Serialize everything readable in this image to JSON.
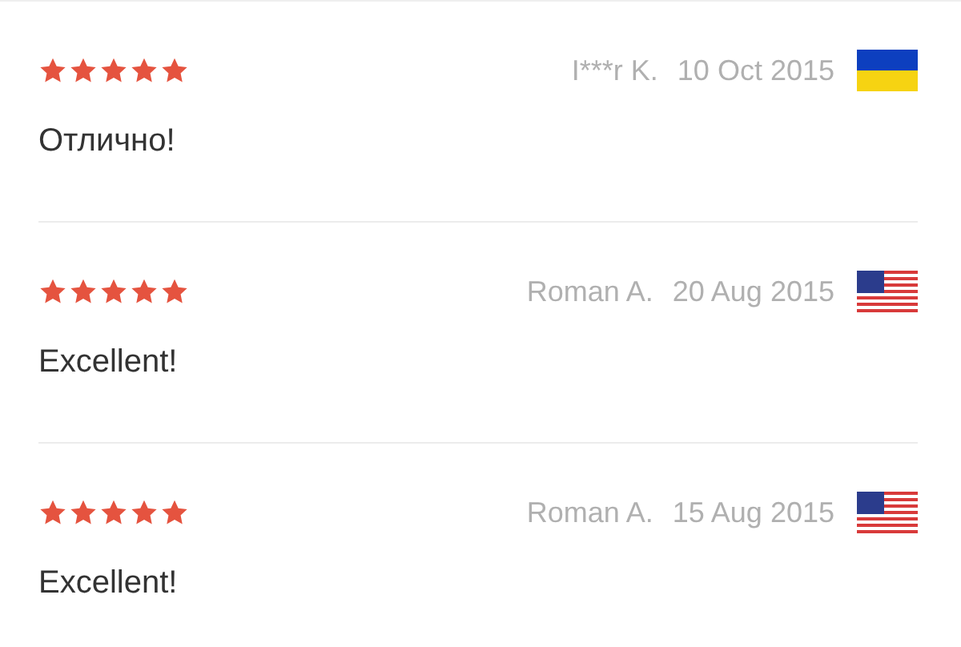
{
  "reviews": [
    {
      "stars": 5,
      "author": "I***r K.",
      "date": "10 Oct 2015",
      "flag": {
        "kind": "ua"
      },
      "text": "Отлично!"
    },
    {
      "stars": 5,
      "author": "Roman A.",
      "date": "20 Aug 2015",
      "flag": {
        "kind": "us"
      },
      "text": "Excellent!"
    },
    {
      "stars": 5,
      "author": "Roman A.",
      "date": "15 Aug 2015",
      "flag": {
        "kind": "us"
      },
      "text": "Excellent!"
    }
  ]
}
